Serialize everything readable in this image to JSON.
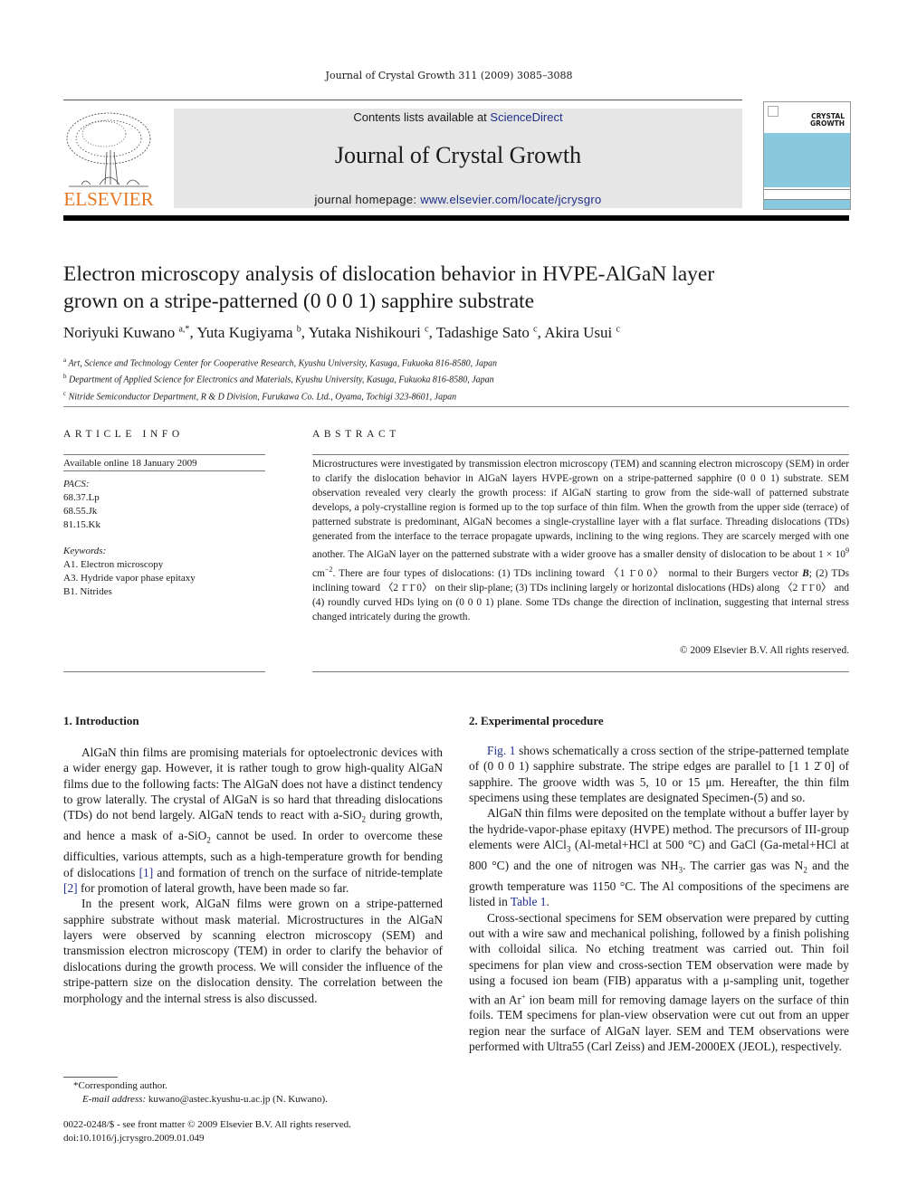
{
  "running_head": "Journal of Crystal Growth 311 (2009) 3085–3088",
  "header": {
    "publisher_logo_text": "ELSEVIER",
    "contents_prefix": "Contents lists available at ",
    "contents_link": "ScienceDirect",
    "journal_title": "Journal of Crystal Growth",
    "homepage_prefix": "journal homepage: ",
    "homepage_link": "www.elsevier.com/locate/jcrysgro",
    "cover_title_line1": "CRYSTAL",
    "cover_title_line2": "GROWTH",
    "colors": {
      "logo_orange": "#e87722",
      "link_blue": "#1f2f8a",
      "banner_gray": "#e6e6e6",
      "cover_blue": "#89c9de"
    }
  },
  "article": {
    "title_line1": "Electron microscopy analysis of dislocation behavior in HVPE-AlGaN layer",
    "title_line2": "grown on a stripe-patterned (0 0 0 1) sapphire substrate",
    "authors": [
      {
        "name": "Noriyuki Kuwano",
        "sup": "a,*",
        "sep": ", "
      },
      {
        "name": "Yuta Kugiyama",
        "sup": "b",
        "sep": ", "
      },
      {
        "name": "Yutaka Nishikouri",
        "sup": "c",
        "sep": ", "
      },
      {
        "name": "Tadashige Sato",
        "sup": "c",
        "sep": ", "
      },
      {
        "name": "Akira Usui",
        "sup": "c",
        "sep": ""
      }
    ],
    "affiliations": [
      {
        "mark": "a",
        "text": "Art, Science and Technology Center for Cooperative Research, Kyushu University, Kasuga, Fukuoka 816-8580, Japan"
      },
      {
        "mark": "b",
        "text": "Department of Applied Science for Electronics and Materials, Kyushu University, Kasuga, Fukuoka 816-8580, Japan"
      },
      {
        "mark": "c",
        "text": "Nitride Semiconductor Department, R & D Division, Furukawa Co. Ltd., Oyama, Tochigi 323-8601, Japan"
      }
    ]
  },
  "article_info": {
    "heading": "ARTICLE INFO",
    "available": "Available online 18 January 2009",
    "pacs_label": "PACS:",
    "pacs": [
      "68.37.Lp",
      "68.55.Jk",
      "81.15.Kk"
    ],
    "keywords_label": "Keywords:",
    "keywords": [
      "A1. Electron microscopy",
      "A3. Hydride vapor phase epitaxy",
      "B1. Nitrides"
    ]
  },
  "abstract": {
    "heading": "ABSTRACT",
    "part1": "Microstructures were investigated by transmission electron microscopy (TEM) and scanning electron microscopy (SEM) in order to clarify the dislocation behavior in AlGaN layers HVPE-grown on a stripe-patterned sapphire (0 0 0 1) substrate. SEM observation revealed very clearly the growth process: if AlGaN starting to grow from the side-wall of patterned substrate develops, a poly-crystalline region is formed up to the top surface of thin film. When the growth from the upper side (terrace) of patterned substrate is predominant, AlGaN becomes a single-crystalline layer with a flat surface. Threading dislocations (TDs) generated from the interface to the terrace propagate upwards, inclining to the wing regions. They are scarcely merged with one another. The AlGaN layer on the patterned substrate with a wider groove has a smaller density of dislocation to be about 1 × 10",
    "exp": "9",
    "part2": " cm",
    "exp2": "−2",
    "part3": ". There are four types of dislocations: (1) TDs inclining toward 〈1 1̄ 0 0〉 normal to their Burgers vector ",
    "bold_b": "B",
    "part4": "; (2) TDs inclining toward 〈2 1̄ 1̄ 0〉 on their slip-plane; (3) TDs inclining largely or horizontal dislocations (HDs) along 〈2 1̄ 1̄ 0〉 and (4) roundly curved HDs lying on (0 0 0 1) plane. Some TDs change the direction of inclination, suggesting that internal stress changed intricately during the growth.",
    "copyright": "© 2009 Elsevier B.V. All rights reserved."
  },
  "introduction": {
    "heading": "1.  Introduction",
    "p1_a": "AlGaN thin films are promising materials for optoelectronic devices with a wider energy gap. However, it is rather tough to grow high-quality AlGaN films due to the following facts: The AlGaN does not have a distinct tendency to grow laterally. The crystal of AlGaN is so hard that threading dislocations (TDs) do not bend largely. AlGaN tends to react with a-SiO",
    "p1_b": " during growth, and hence a mask of a-SiO",
    "p1_c": " cannot be used. In order to overcome these difficulties, various attempts, such as a high-temperature growth for bending of dislocations ",
    "ref1": "[1]",
    "p1_d": " and formation of trench on the surface of nitride-template ",
    "ref2": "[2]",
    "p1_e": " for promotion of lateral growth, have been made so far.",
    "sub2": "2",
    "p2": "In the present work, AlGaN films were grown on a stripe-patterned sapphire substrate without mask material. Microstructures in the AlGaN layers were observed by scanning electron microscopy (SEM) and transmission electron microscopy (TEM) in order to clarify the behavior of dislocations during the growth process. We will consider the influence of the stripe-pattern size on the dislocation density. The correlation between the morphology and the internal stress is also discussed."
  },
  "experimental": {
    "heading": "2.  Experimental procedure",
    "fig_ref": "Fig. 1",
    "p1": " shows schematically a cross section of the stripe-patterned template of (0 0 0 1) sapphire substrate. The stripe edges are parallel to [1 1 2̄ 0] of sapphire. The groove width was 5, 10 or 15 μm. Hereafter, the thin film specimens using these templates are designated Specimen-(5) and so.",
    "p2_a": "AlGaN thin films were deposited on the template without a buffer layer by the hydride-vapor-phase epitaxy (HVPE) method. The precursors of III-group elements were AlCl",
    "p2_b": " (Al-metal+HCl at 500 °C) and GaCl (Ga-metal+HCl at 800 °C) and the one of nitrogen was NH",
    "p2_c": ". The carrier gas was N",
    "p2_d": " and the growth temperature was 1150 °C. The Al compositions of the specimens are listed in ",
    "table_ref": "Table 1",
    "p2_e": ".",
    "sub3": "3",
    "sub2": "2",
    "p3_a": "Cross-sectional specimens for SEM observation were prepared by cutting out with a wire saw and mechanical polishing, followed by a finish polishing with colloidal silica. No etching treatment was carried out. Thin foil specimens for plan view and cross-section TEM observation were made by using a focused ion beam (FIB) apparatus with a μ-sampling unit, together with an Ar",
    "sup_plus": "+",
    "p3_b": " ion beam mill for removing damage layers on the surface of thin foils. TEM specimens for plan-view observation were cut out from an upper region near the surface of AlGaN layer. SEM and TEM observations were performed with Ultra55 (Carl Zeiss) and JEM-2000EX (JEOL), respectively."
  },
  "footnote": {
    "corresponding": "*Corresponding author.",
    "email_label": "E-mail address:",
    "email": " kuwano@astec.kyushu-u.ac.jp (N. Kuwano)."
  },
  "issn_line": "0022-0248/$ - see front matter © 2009 Elsevier B.V. All rights reserved.",
  "doi_line": "doi:10.1016/j.jcrysgro.2009.01.049"
}
